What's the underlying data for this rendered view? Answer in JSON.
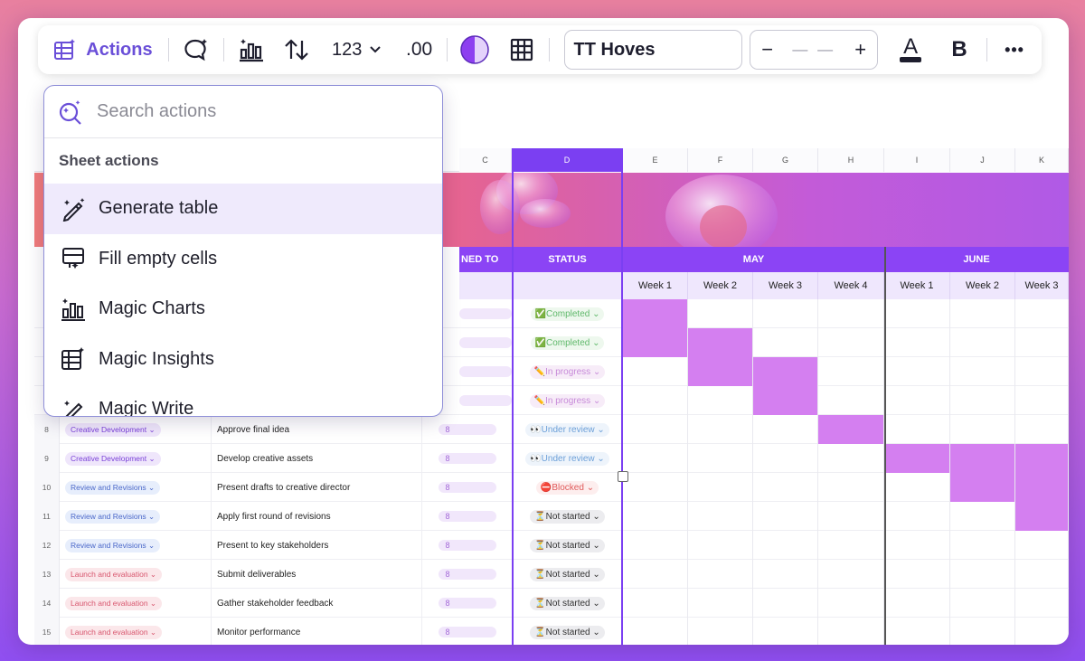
{
  "toolbar": {
    "actions_label": "Actions",
    "number_format_label": "123",
    "decimal_label": ".00",
    "font_name": "TT Hoves",
    "font_size": "— —",
    "minus_label": "−",
    "plus_label": "+",
    "bold_label": "B",
    "more_label": "•••",
    "text_color_label": "A",
    "accent_color": "#6a4fd8"
  },
  "dropdown": {
    "search_placeholder": "Search actions",
    "section_title": "Sheet actions",
    "items": [
      {
        "label": "Generate table",
        "icon": "magic-pen-icon"
      },
      {
        "label": "Fill empty cells",
        "icon": "fill-cells-icon"
      },
      {
        "label": "Magic Charts",
        "icon": "bar-chart-icon"
      },
      {
        "label": "Magic Insights",
        "icon": "table-sparkle-icon"
      },
      {
        "label": "Magic Write",
        "icon": "magic-write-icon"
      }
    ]
  },
  "sheet": {
    "columns": [
      "C",
      "D",
      "E",
      "F",
      "G",
      "H",
      "I",
      "J",
      "K"
    ],
    "selected_column": "D",
    "headers": {
      "assigned": "NED TO",
      "status": "STATUS",
      "may": "MAY",
      "june": "JUNE"
    },
    "weeks": [
      "Week 1",
      "Week 2",
      "Week 3",
      "Week 4",
      "Week 1",
      "Week 2",
      "Week 3"
    ],
    "status_upper": [
      {
        "text": "✅Completed ⌄",
        "kind": "done",
        "fills": [
          0
        ]
      },
      {
        "text": "✅Completed ⌄",
        "kind": "done",
        "fills": [
          0,
          1
        ]
      },
      {
        "text": "✏️In progress ⌄",
        "kind": "prog",
        "fills": [
          1,
          2
        ]
      },
      {
        "text": "✏️In progress ⌄",
        "kind": "prog",
        "fills": [
          2
        ]
      }
    ],
    "rows": [
      {
        "num": "8",
        "phase": "Creative Development ⌄",
        "phase_kind": "cd",
        "task": "Approve final idea",
        "owner": "8",
        "status": "👀Under review ⌄",
        "status_kind": "rev",
        "fills": [
          3
        ]
      },
      {
        "num": "9",
        "phase": "Creative Development ⌄",
        "phase_kind": "cd",
        "task": "Develop creative assets",
        "owner": "8",
        "status": "👀Under review ⌄",
        "status_kind": "rev",
        "fills": [
          4,
          5,
          6
        ]
      },
      {
        "num": "10",
        "phase": "Review and Revisions ⌄",
        "phase_kind": "rr",
        "task": "Present drafts to creative director",
        "owner": "8",
        "status": "⛔Blocked ⌄",
        "status_kind": "blk",
        "fills": [
          5,
          6
        ]
      },
      {
        "num": "11",
        "phase": "Review and Revisions ⌄",
        "phase_kind": "rr",
        "task": "Apply first round of revisions",
        "owner": "8",
        "status": "⏳Not started ⌄",
        "status_kind": "ns",
        "fills": [
          6
        ]
      },
      {
        "num": "12",
        "phase": "Review and Revisions ⌄",
        "phase_kind": "rr",
        "task": "Present to key stakeholders",
        "owner": "8",
        "status": "⏳Not started ⌄",
        "status_kind": "ns",
        "fills": []
      },
      {
        "num": "13",
        "phase": "Launch and evaluation ⌄",
        "phase_kind": "le",
        "task": "Submit deliverables",
        "owner": "8",
        "status": "⏳Not started ⌄",
        "status_kind": "ns",
        "fills": []
      },
      {
        "num": "14",
        "phase": "Launch and evaluation ⌄",
        "phase_kind": "le",
        "task": "Gather stakeholder feedback",
        "owner": "8",
        "status": "⏳Not started ⌄",
        "status_kind": "ns",
        "fills": []
      },
      {
        "num": "15",
        "phase": "Launch and evaluation ⌄",
        "phase_kind": "le",
        "task": "Monitor performance",
        "owner": "8",
        "status": "⏳Not started ⌄",
        "status_kind": "ns",
        "fills": []
      }
    ]
  }
}
